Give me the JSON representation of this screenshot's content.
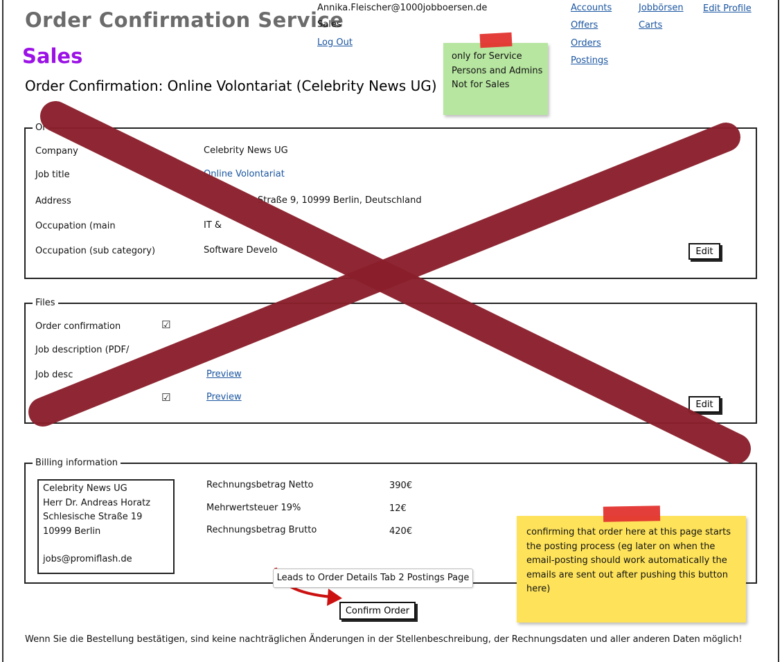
{
  "app_title": "Order Confirmation Service",
  "section": "Sales",
  "page_title": "Order Confirmation: Online Volontariat (Celebrity News UG)",
  "user": {
    "email": "Annika.Fleischer@1000jobboersen.de",
    "role": "Sales",
    "logout": "Log Out"
  },
  "nav": {
    "accounts": "Accounts",
    "offers": "Offers",
    "orders": "Orders",
    "postings": "Postings",
    "jobboersen": "Jobbörsen",
    "carts": "Carts",
    "edit_profile": "Edit Profile"
  },
  "note_green": {
    "lines": [
      "only for Service",
      "Persons and Admins",
      "Not for Sales"
    ]
  },
  "order": {
    "legend": "Or",
    "rows": [
      {
        "label": "Company",
        "value": "Celebrity News UG"
      },
      {
        "label": "Job title",
        "value": "Online Volontariat"
      },
      {
        "label": "Address",
        "value": "Straße 9, 10999 Berlin, Deutschland"
      },
      {
        "label": "Occupation (main",
        "value": "IT &"
      },
      {
        "label": "Occupation (sub category)",
        "value": "Software Develo"
      }
    ],
    "edit": "Edit"
  },
  "files": {
    "legend": "Files",
    "rows": [
      {
        "label": "Order confirmation",
        "check": "☑"
      },
      {
        "label": "Job description (PDF/"
      },
      {
        "label": "Job desc",
        "link": "Preview"
      },
      {
        "check": "☑",
        "link": "Preview"
      }
    ],
    "edit": "Edit"
  },
  "billing": {
    "legend": "Billing information",
    "address": [
      "Celebrity News UG",
      "Herr Dr. Andreas Horatz",
      "Schlesische Straße 19",
      "10999 Berlin",
      "",
      "jobs@promiflash.de"
    ],
    "rows": [
      {
        "label": "Rechnungsbetrag Netto",
        "value": "390€"
      },
      {
        "label": "Mehrwertsteuer 19%",
        "value": "12€"
      },
      {
        "label": "Rechnungsbetrag Brutto",
        "value": "420€"
      }
    ]
  },
  "note_yellow": {
    "lines": [
      "confirming that order here at this page starts",
      "the posting process (eg later on when the",
      "email-posting should work automatically the",
      "emails are sent out after pushing this button",
      "here)"
    ]
  },
  "callout": "Leads to Order Details Tab 2 Postings Page",
  "confirm_button": "Confirm Order",
  "footer": "Wenn Sie die Bestellung bestätigen, sind keine nachträglichen Änderungen in der Stellenbeschreibung, der Rechnungsdaten und aller anderen Daten möglich!",
  "colors": {
    "section": "#9b11e6",
    "link": "#1a55a0",
    "note_green": "#b7e6a0",
    "note_yellow": "#fde25a",
    "tape": "#e3342f",
    "x_mark": "#8a1f2b",
    "arrow": "#cc1111"
  }
}
